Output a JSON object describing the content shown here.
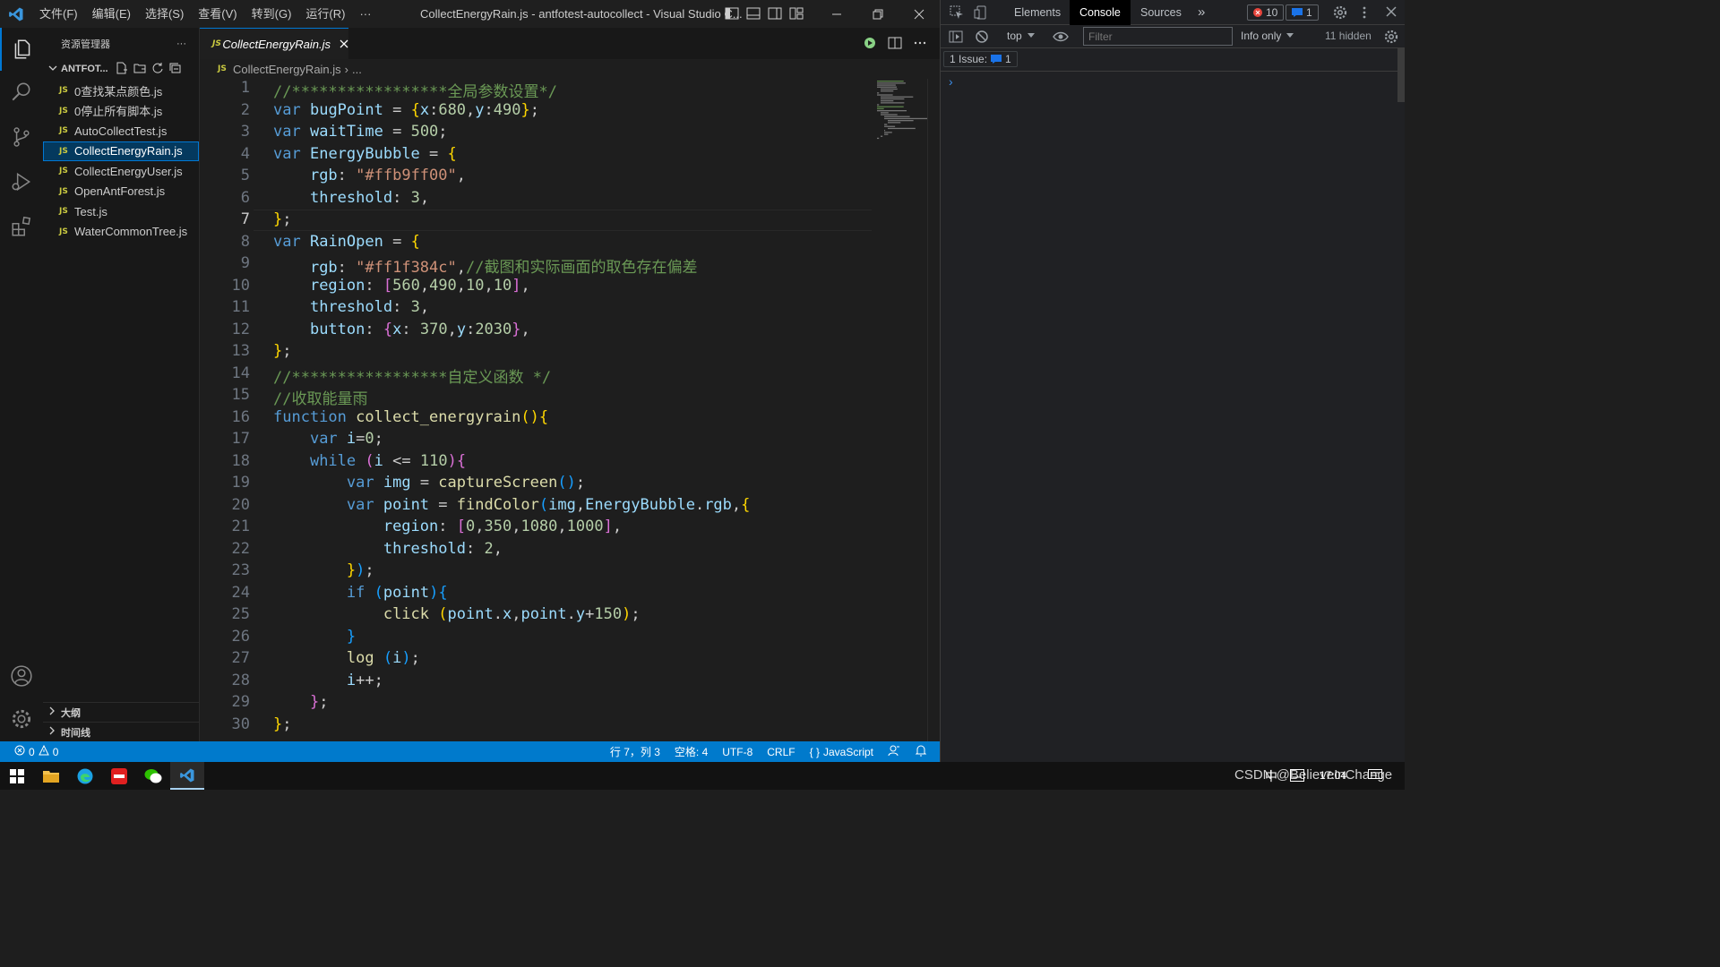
{
  "titlebar": {
    "menu": [
      "文件(F)",
      "编辑(E)",
      "选择(S)",
      "查看(V)",
      "转到(G)",
      "运行(R)",
      "···"
    ],
    "window_title": "CollectEnergyRain.js - antfotest-autocollect - Visual Studio C..."
  },
  "sidebar": {
    "header": "资源管理器",
    "more": "···",
    "folder": "ANTFOT...",
    "files": [
      "0查找某点颜色.js",
      "0停止所有脚本.js",
      "AutoCollectTest.js",
      "CollectEnergyRain.js",
      "CollectEnergyUser.js",
      "OpenAntForest.js",
      "Test.js",
      "WaterCommonTree.js"
    ],
    "file_badge": "JS",
    "outline": "大纲",
    "timeline": "时间线"
  },
  "editor": {
    "tab": "CollectEnergyRain.js",
    "breadcrumb": "CollectEnergyRain.js",
    "breadcrumb_more": "...",
    "code_lines": [
      "//*****************全局参数设置*/",
      "var bugPoint = {x:680,y:490};",
      "var waitTime = 500;",
      "var EnergyBubble = {",
      "    rgb: \"#ffb9ff00\",",
      "    threshold: 3,",
      "};",
      "var RainOpen = {",
      "    rgb: \"#ff1f384c\",//截图和实际画面的取色存在偏差",
      "    region: [560,490,10,10],",
      "    threshold: 3,",
      "    button: {x: 370,y:2030},",
      "};",
      "//*****************自定义函数 */",
      "//收取能量雨",
      "function collect_energyrain(){",
      "    var i=0;",
      "    while (i <= 110){",
      "        var img = captureScreen();",
      "        var point = findColor(img,EnergyBubble.rgb,{",
      "            region: [0,350,1080,1000],",
      "            threshold: 2,",
      "        });",
      "        if (point){",
      "            click (point.x,point.y+150);",
      "        }",
      "        log (i);",
      "        i++;",
      "    };",
      "};"
    ],
    "current_line": 7
  },
  "statusbar": {
    "errors": "0",
    "warnings": "0",
    "position": "行 7，列 3",
    "spaces": "空格: 4",
    "encoding": "UTF-8",
    "eol": "CRLF",
    "language": "JavaScript",
    "language_icon": "{ }"
  },
  "devtools": {
    "tabs": [
      "Elements",
      "Console",
      "Sources"
    ],
    "active_tab": "Console",
    "more_tabs": "»",
    "error_count": "10",
    "message_count": "1",
    "context": "top",
    "filter_placeholder": "Filter",
    "level": "Info only",
    "hidden": "11 hidden",
    "issues_label": "1 Issue:",
    "issues_count": "1",
    "prompt": "›"
  },
  "taskbar": {
    "tray_text": "CSDN @BelieveInChange",
    "ime": "中",
    "clock": "17:04"
  },
  "colors": {
    "accent": "#0078d4",
    "statusbar": "#007acc",
    "keyword": "#569cd6",
    "string": "#ce9178",
    "comment": "#6a9955",
    "number": "#b5cea8",
    "js_badge": "#cbcb41",
    "error": "#e8453c"
  }
}
